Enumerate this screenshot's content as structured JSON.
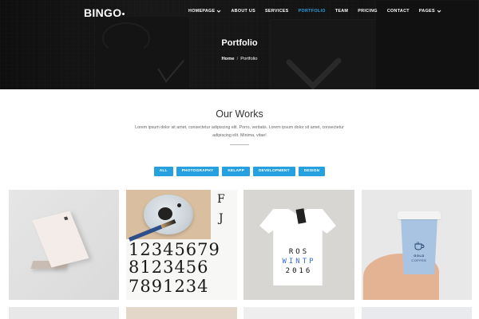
{
  "brand": {
    "logo_text": "BINGO",
    "accent_color": "#27a0e0"
  },
  "nav": {
    "items": [
      {
        "label": "HOMEPAGE",
        "has_dropdown": true,
        "active": false
      },
      {
        "label": "ABOUT US",
        "has_dropdown": false,
        "active": false
      },
      {
        "label": "SERVICES",
        "has_dropdown": false,
        "active": false
      },
      {
        "label": "PORTFOLIO",
        "has_dropdown": false,
        "active": true
      },
      {
        "label": "TEAM",
        "has_dropdown": false,
        "active": false
      },
      {
        "label": "PRICING",
        "has_dropdown": false,
        "active": false
      },
      {
        "label": "CONTACT",
        "has_dropdown": false,
        "active": false
      },
      {
        "label": "PAGES",
        "has_dropdown": true,
        "active": false
      }
    ]
  },
  "hero": {
    "title": "Portfolio",
    "breadcrumb": {
      "home": "Home",
      "separator": "/",
      "current": "Portfolio"
    }
  },
  "works": {
    "title": "Our Works",
    "description": "Lorem ipsum dolor sit amet, consectetur adipiscing elit. Porro, veritatis. Lorem ipsum dolor sit amet, consectetur adipiscing elit. Minima, vitae!",
    "filters": [
      "ALL",
      "PHOTOGRAPHY",
      "KELAPP",
      "DEVELOPMENT",
      "DESIGN"
    ]
  },
  "portfolio": {
    "numbers_art": {
      "line1": "12345679",
      "line2": "8123456",
      "line3": "7891234",
      "side1": "F",
      "side2": "J"
    },
    "tee_text": {
      "line1": "ROS",
      "line2": "WINTP",
      "line3": "2016"
    },
    "cup_text": {
      "line1": "GOLD",
      "line2": "COFFEE"
    }
  },
  "icons": {
    "nav_dropdown": "chevron-down-icon",
    "coffee": "coffee-cup-icon"
  }
}
